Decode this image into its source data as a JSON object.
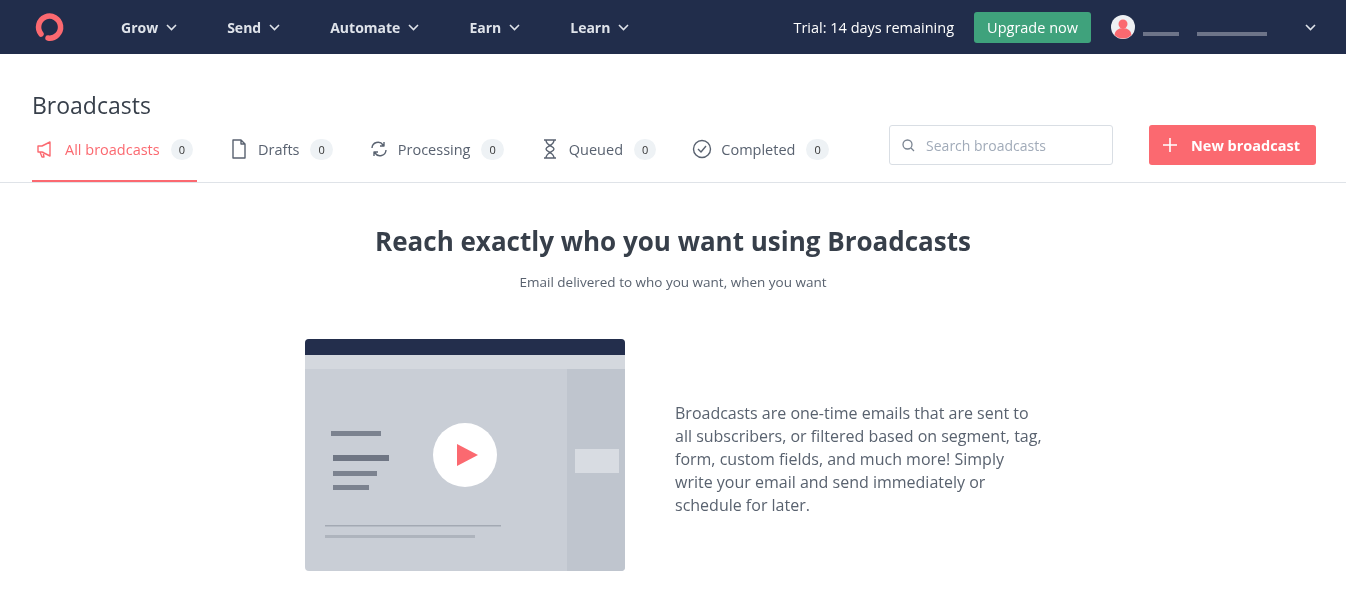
{
  "nav": {
    "items": [
      {
        "label": "Grow"
      },
      {
        "label": "Send"
      },
      {
        "label": "Automate"
      },
      {
        "label": "Earn"
      },
      {
        "label": "Learn"
      }
    ],
    "trial": "Trial: 14 days remaining",
    "upgrade": "Upgrade now"
  },
  "page": {
    "title": "Broadcasts"
  },
  "tabs": [
    {
      "label": "All broadcasts",
      "count": "0",
      "kind": "megaphone",
      "selected": true
    },
    {
      "label": "Drafts",
      "count": "0",
      "kind": "document",
      "selected": false
    },
    {
      "label": "Processing",
      "count": "0",
      "kind": "cycle",
      "selected": false
    },
    {
      "label": "Queued",
      "count": "0",
      "kind": "hourglass",
      "selected": false
    },
    {
      "label": "Completed",
      "count": "0",
      "kind": "check",
      "selected": false
    }
  ],
  "search": {
    "placeholder": "Search broadcasts"
  },
  "new_button": {
    "label": "New broadcast"
  },
  "empty_state": {
    "heading": "Reach exactly who you want using Broadcasts",
    "subheading": "Email delivered to who you want, when you want",
    "description": "Broadcasts are one-time emails that are sent to all subscribers, or filtered based on segment, tag, form, custom fields, and much more! Simply write your email and send immediately or schedule for later."
  }
}
